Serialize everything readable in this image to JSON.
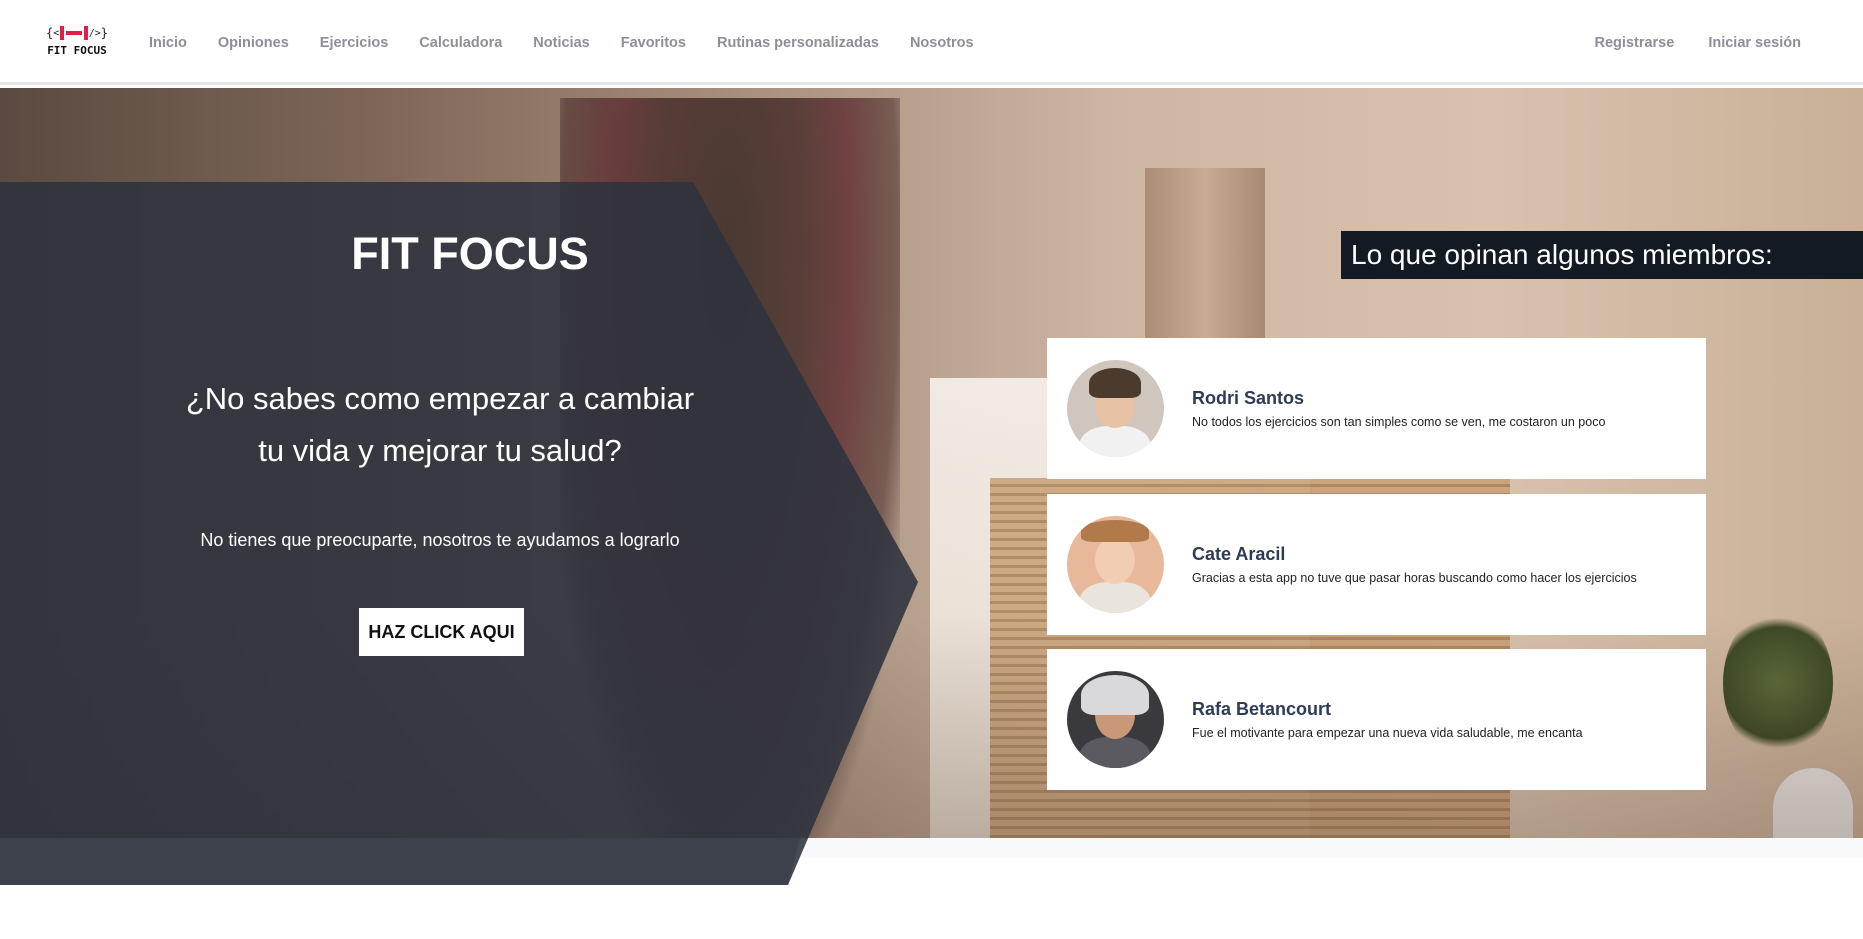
{
  "brand": {
    "logo_glyph": "{<|=|>}",
    "logo_text": "FIT FOCUS",
    "accent_color": "#e11d48"
  },
  "nav": {
    "links": [
      "Inicio",
      "Opiniones",
      "Ejercicios",
      "Calculadora",
      "Noticias",
      "Favoritos",
      "Rutinas personalizadas",
      "Nosotros"
    ],
    "right": [
      "Registrarse",
      "Iniciar sesión"
    ]
  },
  "hero": {
    "title": "FIT FOCUS",
    "question_line1": "¿No sabes como empezar a cambiar",
    "question_line2": "tu vida y mejorar tu salud?",
    "subtitle": "No tienes que preocuparte, nosotros te ayudamos a lograrlo",
    "cta_label": "HAZ CLICK AQUI"
  },
  "opinions": {
    "title": "Lo que opinan algunos miembros:",
    "reviews": [
      {
        "name": "Rodri Santos",
        "comment": "No todos los ejercicios son tan simples como se ven, me costaron un poco"
      },
      {
        "name": "Cate Aracil",
        "comment": "Gracias a esta app no tuve que pasar horas buscando como hacer los ejercicios"
      },
      {
        "name": "Rafa Betancourt",
        "comment": "Fue el motivante para empezar una nueva vida saludable, me encanta"
      }
    ]
  },
  "colors": {
    "panel_dark": "#2d323e",
    "opinions_title_bg": "#141a24",
    "review_name": "#2e3b57",
    "nav_text": "#8b8f99"
  }
}
